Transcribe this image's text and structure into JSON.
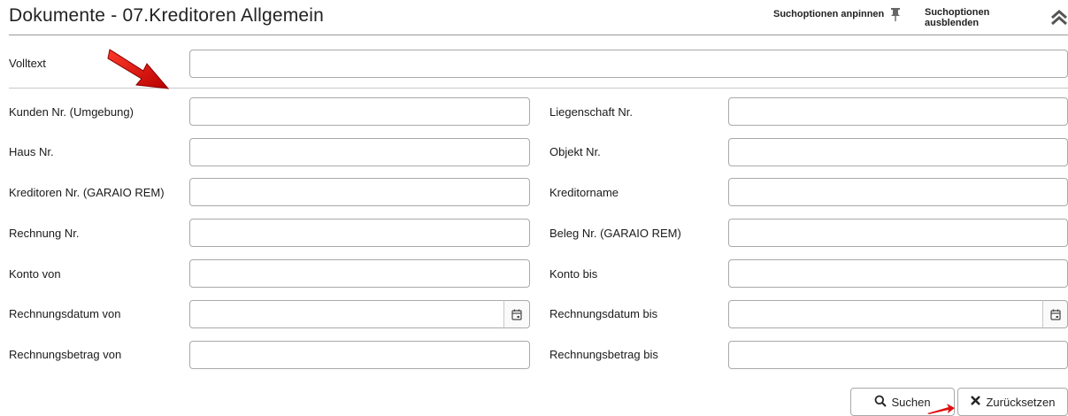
{
  "header": {
    "title": "Dokumente - 07.Kreditoren Allgemein",
    "pin_label": "Suchoptionen anpinnen",
    "hide_label": "Suchoptionen ausblenden"
  },
  "fulltext": {
    "label": "Volltext",
    "value": ""
  },
  "fields": {
    "kunden_nr": {
      "label": "Kunden Nr. (Umgebung)",
      "value": ""
    },
    "liegenschaft_nr": {
      "label": "Liegenschaft Nr.",
      "value": ""
    },
    "haus_nr": {
      "label": "Haus Nr.",
      "value": ""
    },
    "objekt_nr": {
      "label": "Objekt Nr.",
      "value": ""
    },
    "kreditoren_nr": {
      "label": "Kreditoren Nr. (GARAIO REM)",
      "value": ""
    },
    "kreditorname": {
      "label": "Kreditorname",
      "value": ""
    },
    "rechnung_nr": {
      "label": "Rechnung Nr.",
      "value": ""
    },
    "beleg_nr": {
      "label": "Beleg Nr. (GARAIO REM)",
      "value": ""
    },
    "konto_von": {
      "label": "Konto von",
      "value": ""
    },
    "konto_bis": {
      "label": "Konto bis",
      "value": ""
    },
    "rechnungsdatum_von": {
      "label": "Rechnungsdatum von",
      "value": ""
    },
    "rechnungsdatum_bis": {
      "label": "Rechnungsdatum bis",
      "value": ""
    },
    "rechnungsbetrag_von": {
      "label": "Rechnungsbetrag von",
      "value": ""
    },
    "rechnungsbetrag_bis": {
      "label": "Rechnungsbetrag bis",
      "value": ""
    }
  },
  "buttons": {
    "search": "Suchen",
    "reset": "Zurücksetzen"
  },
  "icons": {
    "pin": "pin-icon",
    "hide": "double-chevron-up-icon",
    "calendar": "calendar-icon",
    "search": "search-icon",
    "reset": "close-icon"
  },
  "annotation_color": "#e01010"
}
